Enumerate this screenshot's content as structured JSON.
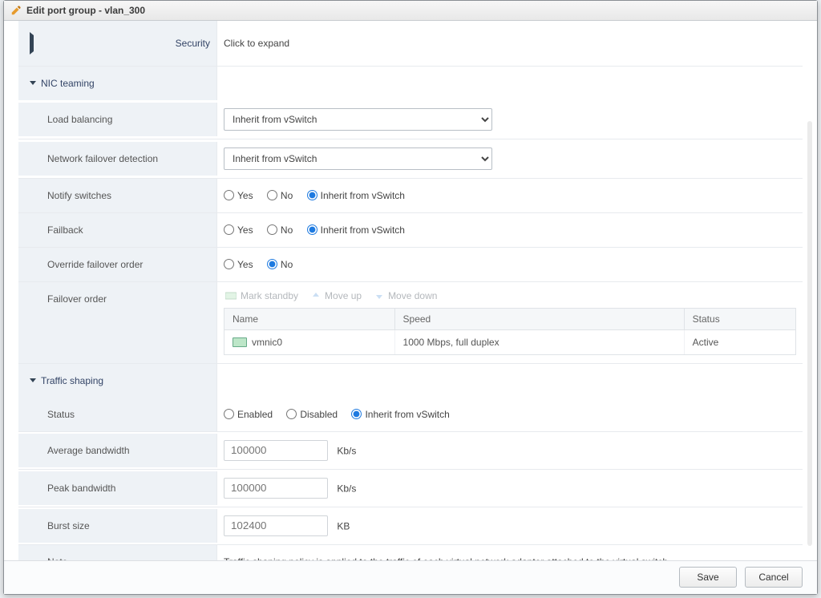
{
  "dialog": {
    "title": "Edit port group - vlan_300"
  },
  "sections": {
    "security": {
      "label": "Security",
      "summary": "Click to expand"
    },
    "nic": {
      "label": "NIC teaming",
      "load_balancing": {
        "label": "Load balancing",
        "value": "Inherit from vSwitch"
      },
      "failover_detection": {
        "label": "Network failover detection",
        "value": "Inherit from vSwitch"
      },
      "notify": {
        "label": "Notify switches",
        "options": {
          "yes": "Yes",
          "no": "No",
          "inherit": "Inherit from vSwitch"
        },
        "selected": "inherit"
      },
      "failback": {
        "label": "Failback",
        "options": {
          "yes": "Yes",
          "no": "No",
          "inherit": "Inherit from vSwitch"
        },
        "selected": "inherit"
      },
      "override": {
        "label": "Override failover order",
        "options": {
          "yes": "Yes",
          "no": "No"
        },
        "selected": "no"
      },
      "order": {
        "label": "Failover order",
        "toolbar": {
          "standby": "Mark standby",
          "up": "Move up",
          "down": "Move down"
        },
        "cols": {
          "name": "Name",
          "speed": "Speed",
          "status": "Status"
        },
        "rows": [
          {
            "name": "vmnic0",
            "speed": "1000 Mbps, full duplex",
            "status": "Active"
          }
        ]
      }
    },
    "shaping": {
      "label": "Traffic shaping",
      "status": {
        "label": "Status",
        "options": {
          "enabled": "Enabled",
          "disabled": "Disabled",
          "inherit": "Inherit from vSwitch"
        },
        "selected": "inherit"
      },
      "avg": {
        "label": "Average bandwidth",
        "placeholder": "100000",
        "unit": "Kb/s"
      },
      "peak": {
        "label": "Peak bandwidth",
        "placeholder": "100000",
        "unit": "Kb/s"
      },
      "burst": {
        "label": "Burst size",
        "placeholder": "102400",
        "unit": "KB"
      },
      "note": {
        "label": "Note",
        "text": "Traffic shaping policy is applied to the traffic of each virtual network adapter attached to the virtual switch."
      }
    }
  },
  "footer": {
    "save": "Save",
    "cancel": "Cancel"
  }
}
